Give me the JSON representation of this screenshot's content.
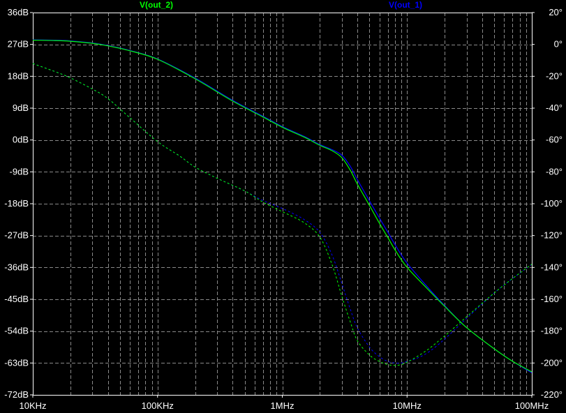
{
  "chart_data": {
    "type": "line",
    "title": "",
    "xlabel": "",
    "ylabel": "",
    "x_scale": "log",
    "xlim": [
      10000,
      100000000
    ],
    "ylim_left": [
      -72,
      36
    ],
    "ylim_right": [
      -220,
      20
    ],
    "grid": true,
    "background": "#000000",
    "grid_color": "#8a8a8a",
    "axis_color": "#ffffff",
    "x_ticks": [
      "10KHz",
      "100KHz",
      "1MHz",
      "10MHz",
      "100MHz"
    ],
    "y_left_ticks": [
      "36dB",
      "27dB",
      "18dB",
      "9dB",
      "0dB",
      "-9dB",
      "-18dB",
      "-27dB",
      "-36dB",
      "-45dB",
      "-54dB",
      "-63dB",
      "-72dB"
    ],
    "y_right_ticks": [
      "20°",
      "0°",
      "-20°",
      "-40°",
      "-60°",
      "-80°",
      "-100°",
      "-120°",
      "-140°",
      "-160°",
      "-180°",
      "-200°",
      "-220°"
    ],
    "series": [
      {
        "name": "V(out_2)",
        "color": "#00ff00",
        "magnitude_db": {
          "x": [
            10000,
            15000,
            20000,
            30000,
            40000,
            60000,
            100000,
            200000,
            400000,
            700000,
            1000000,
            1500000,
            2000000,
            2500000,
            3000000,
            3500000,
            4000000,
            5000000,
            6000000,
            7000000,
            8000000,
            10000000,
            15000000,
            20000000,
            30000000,
            50000000,
            70000000,
            100000000
          ],
          "y": [
            28.2,
            28.1,
            27.9,
            27.3,
            26.6,
            25.2,
            22.8,
            17.3,
            11.0,
            6.5,
            3.6,
            0.8,
            -1.5,
            -3.0,
            -5.0,
            -8.5,
            -12.5,
            -18.5,
            -23.5,
            -27.5,
            -31.0,
            -36.0,
            -42.5,
            -47.0,
            -53.0,
            -59.0,
            -62.5,
            -65.5
          ]
        },
        "phase_deg": {
          "x": [
            10000,
            15000,
            20000,
            30000,
            40000,
            60000,
            100000,
            150000,
            200000,
            300000,
            500000,
            700000,
            1000000,
            1500000,
            2000000,
            2500000,
            3000000,
            3500000,
            4000000,
            5000000,
            6000000,
            7000000,
            8000000,
            9000000,
            10000000,
            12000000,
            15000000,
            20000000,
            30000000,
            50000000,
            70000000,
            100000000
          ],
          "y": [
            -12,
            -17,
            -21,
            -28,
            -34,
            -46,
            -61,
            -70,
            -77,
            -84,
            -92,
            -99,
            -105,
            -112,
            -121,
            -138,
            -158,
            -174,
            -186,
            -195,
            -199,
            -201,
            -201.5,
            -201,
            -199.5,
            -196,
            -191,
            -183,
            -171,
            -156,
            -147,
            -138
          ]
        }
      },
      {
        "name": "V(out_1)",
        "color": "#0000ff",
        "magnitude_db": {
          "x": [
            10000,
            15000,
            20000,
            30000,
            40000,
            60000,
            100000,
            200000,
            400000,
            700000,
            1000000,
            1500000,
            2000000,
            2500000,
            3000000,
            3500000,
            4000000,
            5000000,
            6000000,
            7000000,
            8000000,
            10000000,
            15000000,
            20000000,
            30000000,
            50000000,
            70000000,
            100000000
          ],
          "y": [
            28.3,
            28.2,
            28.0,
            27.4,
            26.7,
            25.3,
            22.9,
            17.5,
            11.2,
            6.7,
            3.8,
            1.0,
            -1.3,
            -2.7,
            -4.3,
            -7.4,
            -11.2,
            -17.2,
            -22.0,
            -26.0,
            -29.5,
            -34.8,
            -42.0,
            -46.8,
            -53.0,
            -59.0,
            -62.5,
            -65.8
          ]
        },
        "phase_deg": {
          "x": [
            10000,
            15000,
            20000,
            30000,
            40000,
            60000,
            100000,
            150000,
            200000,
            300000,
            500000,
            700000,
            1000000,
            1500000,
            2000000,
            2500000,
            3000000,
            3500000,
            4000000,
            5000000,
            6000000,
            7000000,
            8000000,
            9000000,
            10000000,
            12000000,
            15000000,
            20000000,
            30000000,
            50000000,
            70000000,
            100000000
          ],
          "y": [
            -12,
            -17,
            -21,
            -28,
            -34,
            -46,
            -61,
            -70,
            -77,
            -84,
            -92,
            -98,
            -103,
            -110,
            -118,
            -132,
            -150,
            -166,
            -178,
            -190,
            -196,
            -199,
            -200,
            -200,
            -199,
            -197,
            -193,
            -185,
            -172,
            -156,
            -147,
            -138
          ]
        }
      }
    ]
  }
}
